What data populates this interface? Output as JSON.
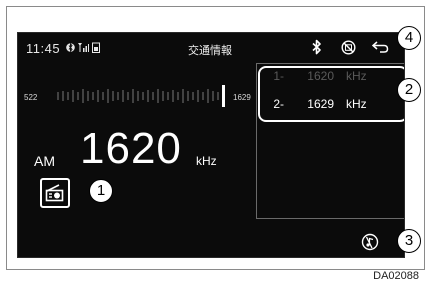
{
  "status": {
    "time": "11:45",
    "title": "交通情報",
    "icons": [
      "bluetooth-status-icon",
      "signal-icon",
      "battery-icon"
    ]
  },
  "tuner": {
    "scale_min": "522",
    "scale_max": "1629",
    "band": "AM",
    "frequency": "1620",
    "unit": "kHz"
  },
  "presets": [
    {
      "index": "1-",
      "frequency": "1620",
      "unit": "kHz",
      "active": false
    },
    {
      "index": "2-",
      "frequency": "1629",
      "unit": "kHz",
      "active": true
    }
  ],
  "top_icons": [
    "bluetooth-icon",
    "no-service-icon",
    "back-arrow-icon"
  ],
  "source_icon": "radio-source-icon",
  "mute_icon": "mute-icon",
  "callouts": [
    "1",
    "2",
    "3",
    "4"
  ],
  "figure_code": "DA02088",
  "colors": {
    "screen_bg": "#0b0b0b",
    "text": "#ffffff",
    "dim_text": "#5a5a5a"
  }
}
